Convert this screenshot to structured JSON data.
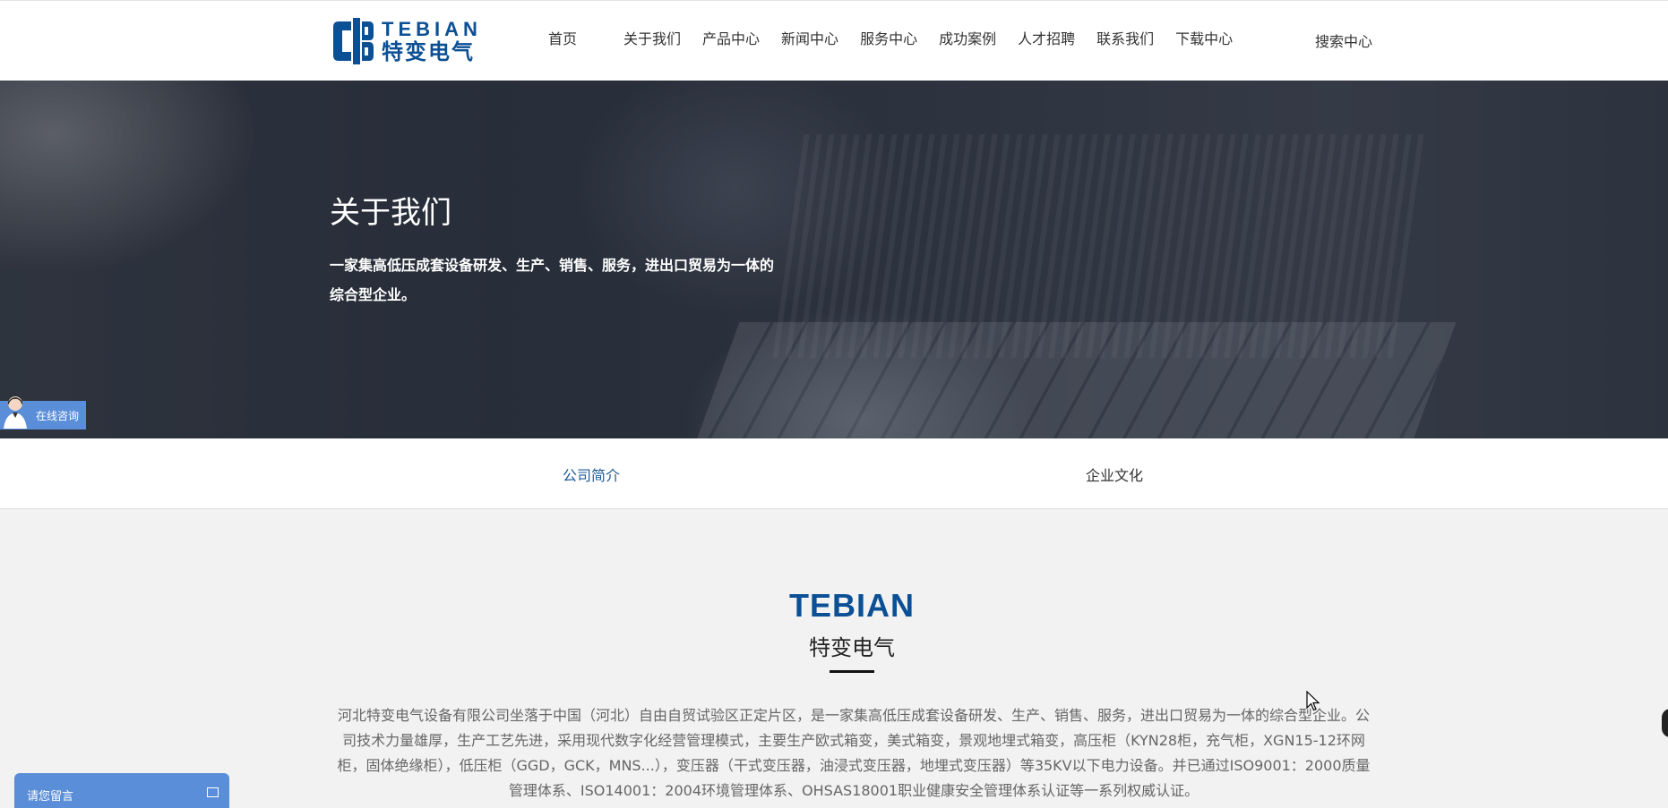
{
  "header": {
    "logo": {
      "en": "TEBIAN",
      "cn": "特变电气"
    },
    "nav": [
      "首页",
      "关于我们",
      "产品中心",
      "新闻中心",
      "服务中心",
      "成功案例",
      "人才招聘",
      "联系我们",
      "下载中心"
    ],
    "search_label": "搜索中心"
  },
  "hero": {
    "title": "关于我们",
    "subtitle": "一家集高低压成套设备研发、生产、销售、服务，进出口贸易为一体的综合型企业。"
  },
  "consult": {
    "label": "在线咨询"
  },
  "subtabs": [
    {
      "label": "公司简介",
      "active": true
    },
    {
      "label": "企业文化",
      "active": false
    }
  ],
  "content": {
    "brand_en": "TEBIAN",
    "brand_cn": "特变电气",
    "intro": "河北特变电气设备有限公司坐落于中国（河北）自由自贸试验区正定片区，是一家集高低压成套设备研发、生产、销售、服务，进出口贸易为一体的综合型企业。公司技术力量雄厚，生产工艺先进，采用现代数字化经营管理模式，主要生产欧式箱变，美式箱变，景观地埋式箱变，高压柜（KYN28柜，充气柜，XGN15-12环网柜，固体绝缘柜），低压柜（GGD，GCK，MNS...），变压器（干式变压器，油浸式变压器，地埋式变压器）等35KV以下电力设备。并已通过ISO9001：2000质量管理体系、ISO14001：2004环境管理体系、OHSAS18001职业健康安全管理体系认证等一系列权威认证。"
  },
  "message_box": {
    "label": "请您留言"
  },
  "colors": {
    "brand_blue": "#0b4f95",
    "widget_blue": "#5b8ed8",
    "active_tab": "#1c5a96"
  }
}
